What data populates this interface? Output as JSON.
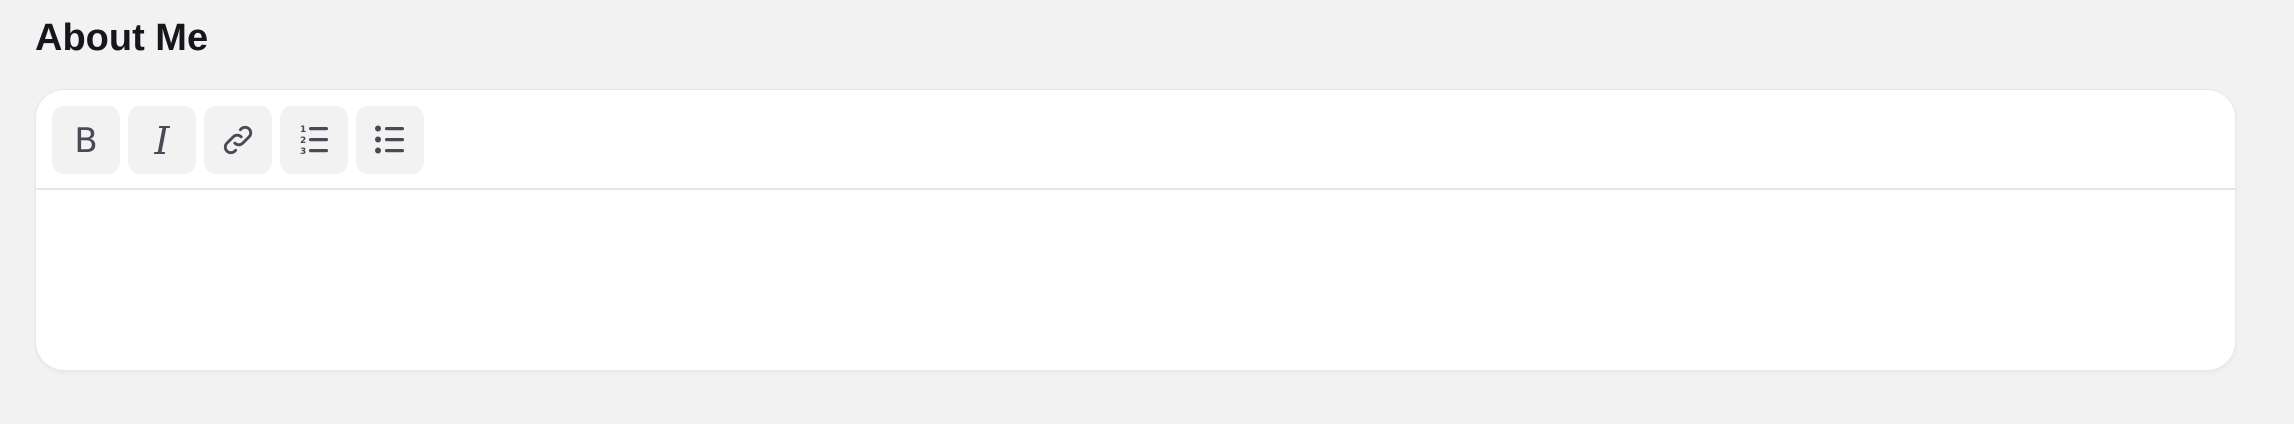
{
  "section": {
    "title": "About Me"
  },
  "toolbar": {
    "buttons": [
      {
        "name": "bold",
        "icon": "bold-icon"
      },
      {
        "name": "italic",
        "icon": "italic-icon"
      },
      {
        "name": "link",
        "icon": "link-icon"
      },
      {
        "name": "ordered-list",
        "icon": "ordered-list-icon"
      },
      {
        "name": "bullet-list",
        "icon": "bullet-list-icon"
      }
    ]
  },
  "editor": {
    "content": ""
  },
  "colors": {
    "page_background": "#f2f2f2",
    "panel_background": "#ffffff",
    "button_background": "#f2f2f3",
    "icon_color": "#4a4955",
    "title_color": "#17161c"
  }
}
